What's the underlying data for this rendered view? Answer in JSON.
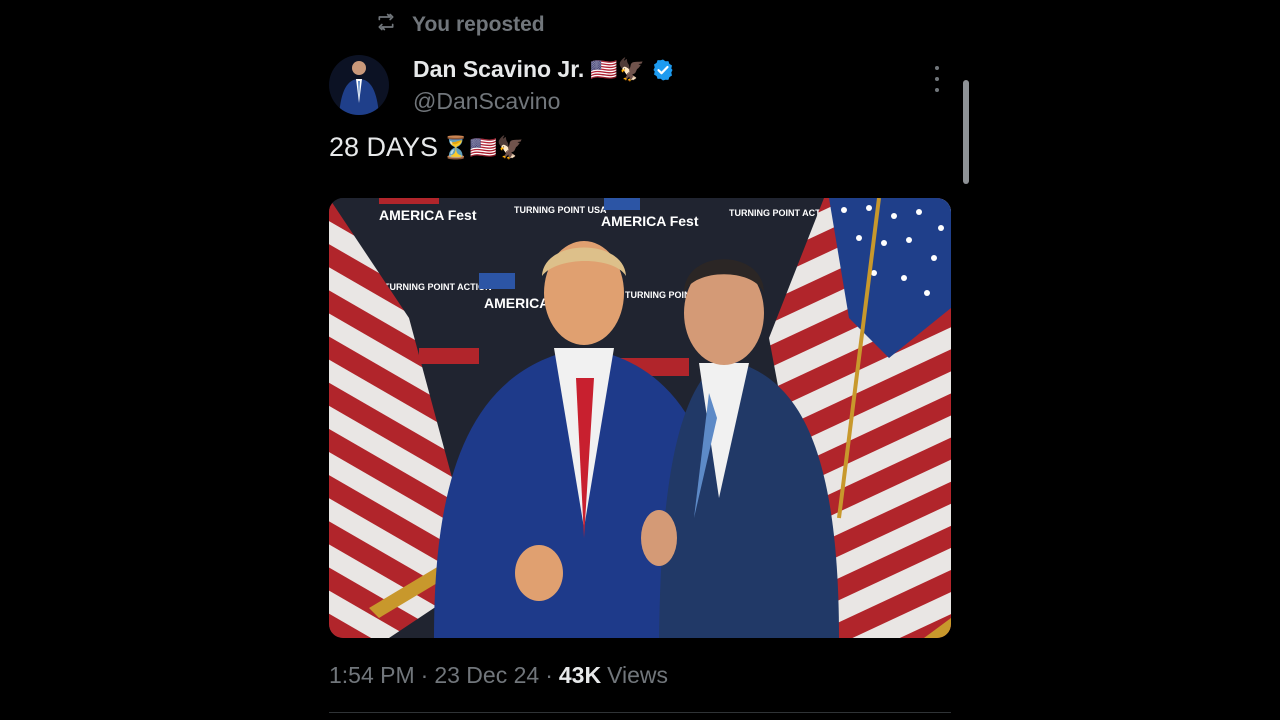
{
  "repost": {
    "label": "You reposted",
    "icon": "repost-icon"
  },
  "author": {
    "display_name": "Dan Scavino Jr.",
    "name_emoji": "🇺🇸🦅",
    "handle": "@DanScavino",
    "verified": true,
    "verified_color": "#1d9bf0"
  },
  "tweet": {
    "text": "28 DAYS",
    "text_emoji": "⏳🇺🇸🦅",
    "image_banner_texts": [
      "AMERICA Fest",
      "TURNING POINT USA",
      "TURNING POINT ACTION"
    ]
  },
  "meta": {
    "time": "1:54 PM",
    "separator": "·",
    "date": "23 Dec 24",
    "views_count": "43K",
    "views_label": "Views"
  },
  "colors": {
    "background": "#000000",
    "text": "#e7e9ea",
    "secondary": "#71767b"
  }
}
